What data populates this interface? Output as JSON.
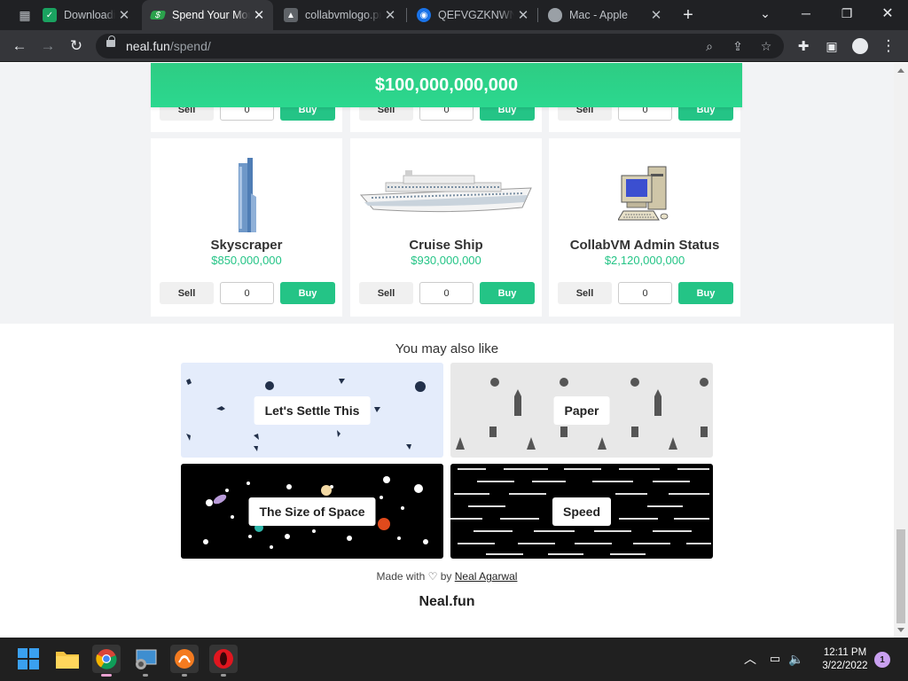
{
  "browser": {
    "tabs": [
      {
        "title": "Downloading",
        "favicon": "download-check-icon"
      },
      {
        "title": "Spend Your Money",
        "favicon": "money-icon"
      },
      {
        "title": "collabvmlogo.png",
        "favicon": "image-icon"
      },
      {
        "title": "QEFVGZKNWNQ",
        "favicon": "site-icon"
      },
      {
        "title": "Mac - Apple",
        "favicon": "apple-icon"
      }
    ],
    "url_host": "neal.fun",
    "url_path": "/spend/"
  },
  "page": {
    "balance": "$100,000,000,000",
    "top_row": [
      {
        "sell": "Sell",
        "qty": "0",
        "buy": "Buy"
      },
      {
        "sell": "Sell",
        "qty": "0",
        "buy": "Buy"
      },
      {
        "sell": "Sell",
        "qty": "0",
        "buy": "Buy"
      }
    ],
    "items": [
      {
        "name": "Skyscraper",
        "price": "$850,000,000",
        "sell": "Sell",
        "qty": "0",
        "buy": "Buy"
      },
      {
        "name": "Cruise Ship",
        "price": "$930,000,000",
        "sell": "Sell",
        "qty": "0",
        "buy": "Buy"
      },
      {
        "name": "CollabVM Admin Status",
        "price": "$2,120,000,000",
        "sell": "Sell",
        "qty": "0",
        "buy": "Buy"
      }
    ],
    "also_heading": "You may also like",
    "promos": [
      {
        "label": "Let's Settle This"
      },
      {
        "label": "Paper"
      },
      {
        "label": "The Size of Space"
      },
      {
        "label": "Speed"
      }
    ],
    "footer_made": "Made with",
    "footer_by": "by",
    "footer_author": "Neal Agarwal",
    "brand": "Neal.fun"
  },
  "taskbar": {
    "time": "12:11 PM",
    "date": "3/22/2022",
    "notification_count": "1"
  },
  "colors": {
    "accent_green": "#24c486",
    "tab_strip": "#202124",
    "toolbar": "#35363a"
  }
}
